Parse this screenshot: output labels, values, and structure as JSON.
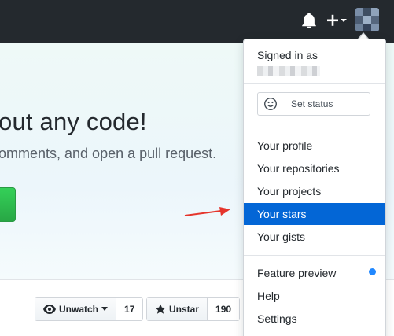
{
  "header": {
    "icons": {
      "notification": "bell-icon",
      "create": "plus-icon",
      "create_caret": "caret-down-icon",
      "avatar": "avatar"
    }
  },
  "hero": {
    "title": "out any code!",
    "subtitle": "omments, and open a pull request."
  },
  "repo_actions": {
    "watch": {
      "label": "Unwatch",
      "count": "17",
      "icon": "eye-icon"
    },
    "star": {
      "label": "Unstar",
      "count": "190",
      "icon": "star-icon"
    }
  },
  "dropdown": {
    "signed_in_label": "Signed in as",
    "set_status_label": "Set status",
    "items_group1": [
      {
        "label": "Your profile",
        "active": false
      },
      {
        "label": "Your repositories",
        "active": false
      },
      {
        "label": "Your projects",
        "active": false
      },
      {
        "label": "Your stars",
        "active": true
      },
      {
        "label": "Your gists",
        "active": false
      }
    ],
    "items_group2": [
      {
        "label": "Feature preview",
        "indicator": true
      },
      {
        "label": "Help"
      },
      {
        "label": "Settings"
      }
    ]
  },
  "colors": {
    "header_bg": "#24292e",
    "active_item_bg": "#0366d6",
    "indicator_dot": "#2188ff",
    "annotation_arrow": "#e5352c",
    "primary_button": "#28a745"
  }
}
